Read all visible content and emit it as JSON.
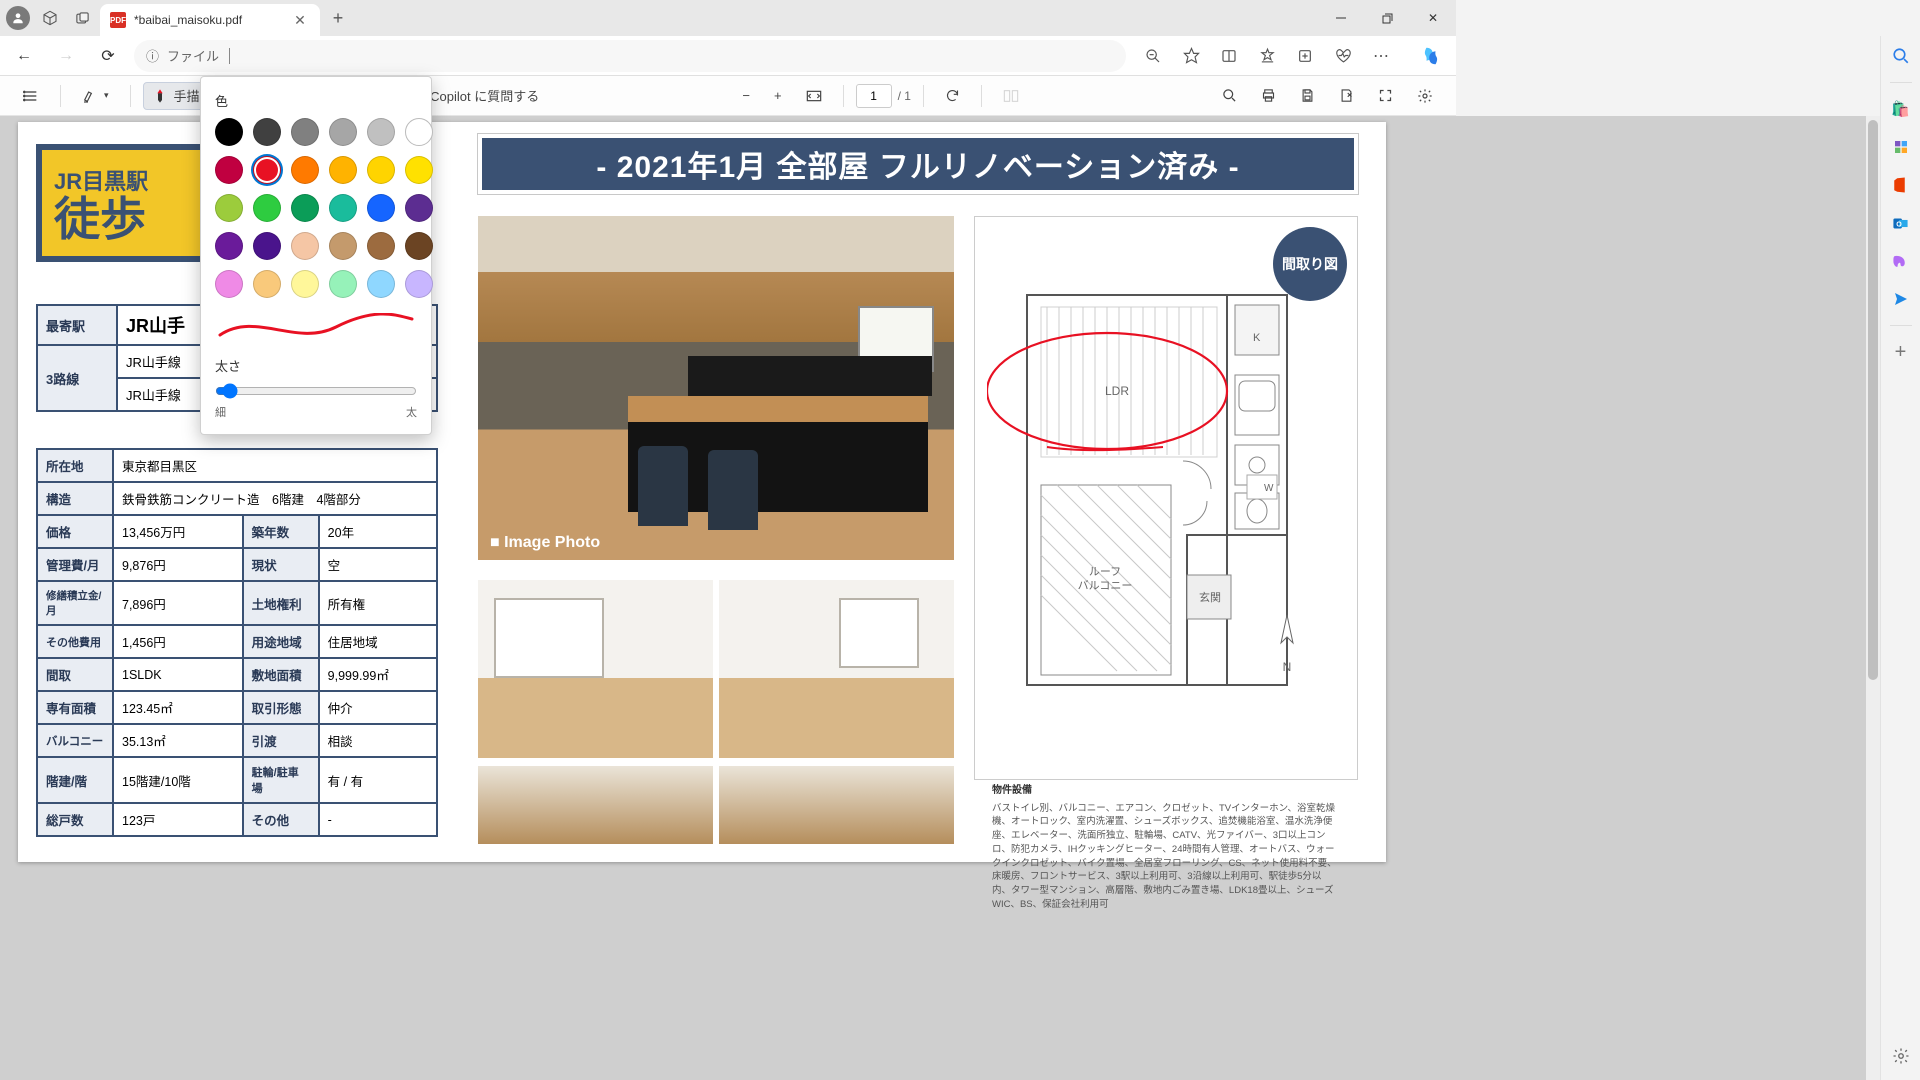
{
  "titlebar": {
    "tab_title": "*baibai_maisoku.pdf"
  },
  "addressbar": {
    "label": "ファイル",
    "info_icon": "ⓘ"
  },
  "pdf_toolbar": {
    "draw_label": "手描き",
    "copilot_label": "Copilot に質問する",
    "page_current": "1",
    "page_total": "/ 1"
  },
  "popover": {
    "color_label": "色",
    "thickness_label": "太さ",
    "thin": "細",
    "thick": "太",
    "colors_row1": [
      "#000000",
      "#404040",
      "#808080",
      "#a6a6a6",
      "#c0c0c0",
      "#ffffff"
    ],
    "colors_row2": [
      "#c00040",
      "#e81123",
      "#ff7a00",
      "#ffb300",
      "#ffd400",
      "#ffe100"
    ],
    "colors_row3": [
      "#9ccc3c",
      "#2ecc40",
      "#0b9d58",
      "#1abc9c",
      "#1565ff",
      "#5c2d91"
    ],
    "colors_row4": [
      "#6a1b9a",
      "#4a148c",
      "#f5c6a5",
      "#c49a6c",
      "#9c6b3f",
      "#6b4423"
    ],
    "colors_row5": [
      "#ef8ae6",
      "#f9c97b",
      "#fff79a",
      "#96f2b9",
      "#8fd7ff",
      "#c8b6ff"
    ],
    "selected_index": 7
  },
  "doc": {
    "banner": "- 2021年1月  全部屋 フルリノベーション済み -",
    "badge_line1": "JR目黒駅",
    "badge_line2": "徒歩",
    "image_label": "■ Image Photo",
    "floorplan_badge": "間取り図",
    "fp_k": "K",
    "fp_ldr": "LDR",
    "fp_balcony": "ルーフ\nバルコニー",
    "fp_w": "W",
    "fp_genkan": "玄関",
    "fp_n": "N",
    "equip_title": "物件設備",
    "equip_body": "バストイレ別、バルコニー、エアコン、クロゼット、TVインターホン、浴室乾燥機、オートロック、室内洗濯置、シューズボックス、追焚機能浴室、温水洗浄便座、エレベーター、洗面所独立、駐輪場、CATV、光ファイバー、3口以上コンロ、防犯カメラ、IHクッキングヒーター、24時間有人管理、オートバス、ウォークインクロゼット、バイク置場、全居室フローリング、CS、ネット使用料不要、床暖房、フロントサービス、3駅以上利用可、3沿線以上利用可、駅徒歩5分以内、タワー型マンション、高層階、敷地内ごみ置き場、LDK18畳以上、シューズWIC、BS、保証会社利用可",
    "table_top": {
      "r1_th": "最寄駅",
      "r1_td": "JR山手",
      "r2_th": "3路線",
      "r2_td1": "JR山手線",
      "r2_td2": "JR山手線"
    },
    "table": {
      "r_addr_th": "所在地",
      "r_addr_td": "東京都目黒区",
      "r_struct_th": "構造",
      "r_struct_td": "鉄骨鉄筋コンクリート造　6階建　4階部分",
      "r_price_th": "価格",
      "r_price_td": "13,456万円",
      "r_year_th": "築年数",
      "r_year_td": "20年",
      "r_kanri_th": "管理費/月",
      "r_kanri_td": "9,876円",
      "r_genjo_th": "現状",
      "r_genjo_td": "空",
      "r_shuzen_th": "修繕積立金/月",
      "r_shuzen_td": "7,896円",
      "r_tochi_th": "土地権利",
      "r_tochi_td": "所有権",
      "r_sonota_th": "その他費用",
      "r_sonota_td": "1,456円",
      "r_youto_th": "用途地域",
      "r_youto_td": "住居地域",
      "r_madori_th": "間取",
      "r_madori_td": "1SLDK",
      "r_shikichi_th": "敷地面積",
      "r_shikichi_td": "9,999.99㎡",
      "r_senyuu_th": "専有面積",
      "r_senyuu_td": "123.45㎡",
      "r_torihiki_th": "取引形態",
      "r_torihiki_td": "仲介",
      "r_balcony_th": "バルコニー",
      "r_balcony_td": "35.13㎡",
      "r_hikiwatashi_th": "引渡",
      "r_hikiwatashi_td": "相談",
      "r_kaidate_th": "階建/階",
      "r_kaidate_td": "15階建/10階",
      "r_churin_th": "駐輪/駐車場",
      "r_churin_td": "有 / 有",
      "r_souko_th": "総戸数",
      "r_souko_td": "123戸",
      "r_other_th": "その他",
      "r_other_td": "-"
    }
  }
}
